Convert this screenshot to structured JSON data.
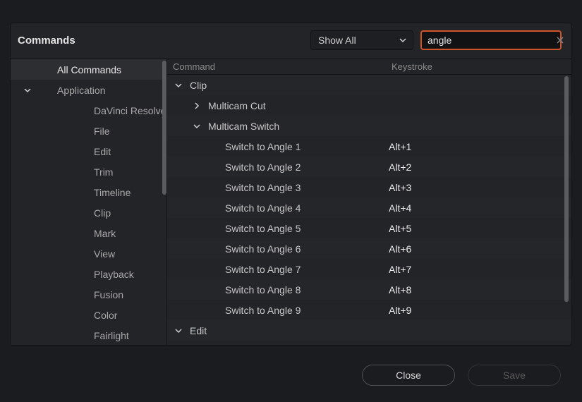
{
  "header": {
    "title": "Commands",
    "filter_selected": "Show All",
    "search_value": "angle"
  },
  "sidebar": {
    "items": [
      {
        "label": "All Commands",
        "indent": 1,
        "chev": null,
        "active": true
      },
      {
        "label": "Application",
        "indent": 1,
        "chev": "down",
        "active": false
      },
      {
        "label": "DaVinci Resolve",
        "indent": 2,
        "chev": null,
        "active": false
      },
      {
        "label": "File",
        "indent": 2,
        "chev": null,
        "active": false
      },
      {
        "label": "Edit",
        "indent": 2,
        "chev": null,
        "active": false
      },
      {
        "label": "Trim",
        "indent": 2,
        "chev": null,
        "active": false
      },
      {
        "label": "Timeline",
        "indent": 2,
        "chev": null,
        "active": false
      },
      {
        "label": "Clip",
        "indent": 2,
        "chev": null,
        "active": false
      },
      {
        "label": "Mark",
        "indent": 2,
        "chev": null,
        "active": false
      },
      {
        "label": "View",
        "indent": 2,
        "chev": null,
        "active": false
      },
      {
        "label": "Playback",
        "indent": 2,
        "chev": null,
        "active": false
      },
      {
        "label": "Fusion",
        "indent": 2,
        "chev": null,
        "active": false
      },
      {
        "label": "Color",
        "indent": 2,
        "chev": null,
        "active": false
      },
      {
        "label": "Fairlight",
        "indent": 2,
        "chev": null,
        "active": false
      }
    ]
  },
  "table": {
    "col_command": "Command",
    "col_keystroke": "Keystroke",
    "rows": [
      {
        "label": "Clip",
        "key": "",
        "depth": 0,
        "chev": "down"
      },
      {
        "label": "Multicam Cut",
        "key": "",
        "depth": 1,
        "chev": "right"
      },
      {
        "label": "Multicam Switch",
        "key": "",
        "depth": 1,
        "chev": "down"
      },
      {
        "label": "Switch to Angle 1",
        "key": "Alt+1",
        "depth": 3,
        "chev": null
      },
      {
        "label": "Switch to Angle 2",
        "key": "Alt+2",
        "depth": 3,
        "chev": null
      },
      {
        "label": "Switch to Angle 3",
        "key": "Alt+3",
        "depth": 3,
        "chev": null
      },
      {
        "label": "Switch to Angle 4",
        "key": "Alt+4",
        "depth": 3,
        "chev": null
      },
      {
        "label": "Switch to Angle 5",
        "key": "Alt+5",
        "depth": 3,
        "chev": null
      },
      {
        "label": "Switch to Angle 6",
        "key": "Alt+6",
        "depth": 3,
        "chev": null
      },
      {
        "label": "Switch to Angle 7",
        "key": "Alt+7",
        "depth": 3,
        "chev": null
      },
      {
        "label": "Switch to Angle 8",
        "key": "Alt+8",
        "depth": 3,
        "chev": null
      },
      {
        "label": "Switch to Angle 9",
        "key": "Alt+9",
        "depth": 3,
        "chev": null
      },
      {
        "label": "Edit",
        "key": "",
        "depth": 0,
        "chev": "down"
      }
    ]
  },
  "footer": {
    "close": "Close",
    "save": "Save"
  }
}
